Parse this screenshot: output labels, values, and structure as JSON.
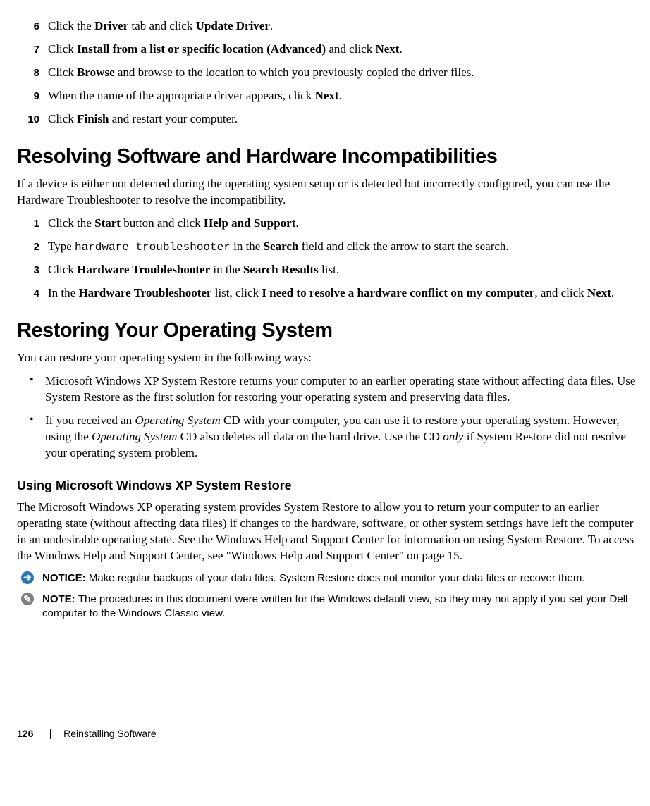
{
  "steps_top": [
    {
      "n": "6",
      "pre": "Click the ",
      "b1": "Driver",
      "mid1": " tab and click ",
      "b2": "Update Driver",
      "post": "."
    },
    {
      "n": "7",
      "pre": "Click ",
      "b1": "Install from a list or specific location (Advanced)",
      "mid1": " and click ",
      "b2": "Next",
      "post": "."
    },
    {
      "n": "8",
      "pre": "Click ",
      "b1": "Browse",
      "mid1": " and browse to the location to which you previously copied the driver files.",
      "b2": "",
      "post": ""
    },
    {
      "n": "9",
      "pre": "When the name of the appropriate driver appears, click ",
      "b1": "Next",
      "mid1": ".",
      "b2": "",
      "post": ""
    },
    {
      "n": "10",
      "pre": "Click ",
      "b1": "Finish",
      "mid1": " and restart your computer.",
      "b2": "",
      "post": ""
    }
  ],
  "heading1": "Resolving Software and Hardware Incompatibilities",
  "para1": "If a device is either not detected during the operating system setup or is detected but incorrectly configured, you can use the Hardware Troubleshooter to resolve the incompatibility.",
  "steps_mid": {
    "s1": {
      "n": "1",
      "pre": "Click the ",
      "b1": "Start",
      "mid": " button and click ",
      "b2": "Help and Support",
      "post": "."
    },
    "s2": {
      "n": "2",
      "pre": "Type ",
      "code": "hardware troubleshooter",
      "mid": " in the ",
      "b1": "Search",
      "post": " field and click the arrow to start the search."
    },
    "s3": {
      "n": "3",
      "pre": "Click ",
      "b1": "Hardware Troubleshooter",
      "mid": " in the ",
      "b2": "Search Results",
      "post": " list."
    },
    "s4": {
      "n": "4",
      "pre": "In the ",
      "b1": "Hardware Troubleshooter",
      "mid": " list, click ",
      "b2": "I need to resolve a hardware conflict on my computer",
      "post": ", and click ",
      "b3": "Next",
      "post2": "."
    }
  },
  "heading2": "Restoring Your Operating System",
  "para2": "You can restore your operating system in the following ways:",
  "bullets": {
    "b1": "Microsoft Windows XP System Restore returns your computer to an earlier operating state without affecting data files. Use System Restore as the first solution for restoring your operating system and preserving data files.",
    "b2_pre": "If you received an ",
    "b2_i1": "Operating System",
    "b2_mid": " CD with your computer, you can use it to restore your operating system. However, using the ",
    "b2_i2": "Operating System",
    "b2_mid2": " CD also deletes all data on the hard drive. Use the CD ",
    "b2_i3": "only",
    "b2_post": " if System Restore did not resolve your operating system problem."
  },
  "subheading": "Using Microsoft Windows XP System Restore",
  "para3": "The Microsoft Windows XP operating system provides System Restore to allow you to return your computer to an earlier operating state (without affecting data files) if changes to the hardware, software, or other system settings have left the computer in an undesirable operating state. See the Windows Help and Support Center for information on using System Restore. To access the Windows Help and Support Center, see \"Windows Help and Support Center\" on page 15.",
  "notice": {
    "label": "NOTICE: ",
    "text": "Make regular backups of your data files. System Restore does not monitor your data files or recover them."
  },
  "note": {
    "label": "NOTE: ",
    "text": "The procedures in this document were written for the Windows default view, so they may not apply if you set your Dell computer to the Windows Classic view."
  },
  "footer": {
    "page": "126",
    "title": "Reinstalling Software"
  },
  "icons": {
    "notice_glyph": "➜",
    "note_glyph": "✎"
  }
}
